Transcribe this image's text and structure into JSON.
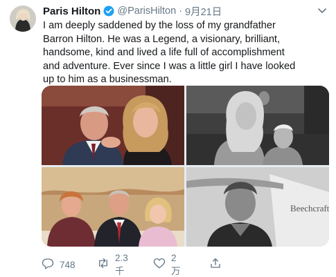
{
  "tweet": {
    "name": "Paris Hilton",
    "handle": "@ParisHilton",
    "separator": "·",
    "date": "9月21日",
    "text_lines": [
      "I am deeply saddened by the loss of my grandfather",
      "Barron Hilton. He was a Legend, a visionary, brilliant,",
      "handsome, kind and lived a life full of accomplishment",
      "and adventure. Ever since I was a little girl I have looked",
      "up to him as a businessman."
    ],
    "photo_sign": "Beechcraft"
  },
  "actions": {
    "replies": "748",
    "retweets": "2.3千",
    "likes": "2万"
  },
  "colors": {
    "text": "#14171a",
    "secondary": "#657786",
    "verified": "#1da1f2"
  },
  "icons": [
    "verified-icon",
    "chevron-down-icon",
    "reply-icon",
    "retweet-icon",
    "like-icon",
    "share-icon"
  ]
}
